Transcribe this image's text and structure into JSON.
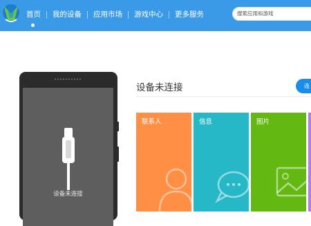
{
  "header": {
    "nav": [
      {
        "label": "首页",
        "active": true
      },
      {
        "label": "我的设备"
      },
      {
        "label": "应用市场"
      },
      {
        "label": "游戏中心"
      },
      {
        "label": "更多服务"
      }
    ],
    "search": {
      "placeholder": "搜索应用和游戏"
    }
  },
  "device": {
    "status_text": "设备未连接",
    "panel_title": "设备未连接"
  },
  "tiles": [
    {
      "label": "联系人",
      "color": "#ff8f45",
      "icon": "contact-icon"
    },
    {
      "label": "信息",
      "color": "#26b8c6",
      "icon": "message-icon"
    },
    {
      "label": "图片",
      "color": "#63b812",
      "icon": "picture-icon"
    }
  ],
  "colors": {
    "header": "#3a9ae8",
    "accent_button": "#1a8ceb",
    "phone_body": "#2b2b2b",
    "phone_screen": "#5e5e5e",
    "fourth_tile_edge": "#b67af0"
  }
}
